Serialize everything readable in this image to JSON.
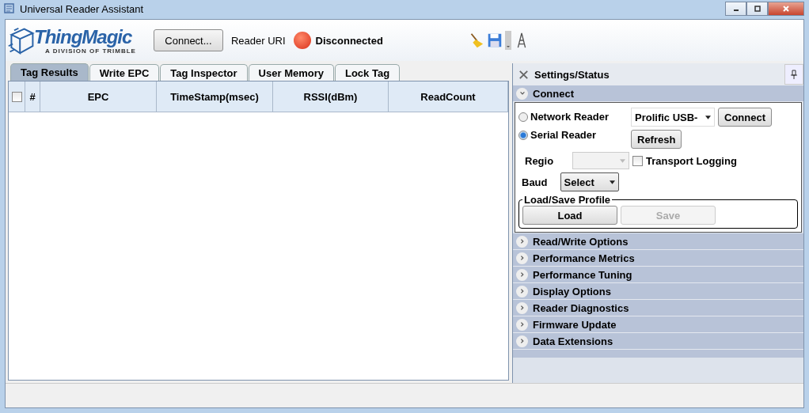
{
  "window": {
    "title": "Universal Reader Assistant"
  },
  "logo": {
    "name": "ThingMagic",
    "tagline": "A DIVISION OF TRIMBLE"
  },
  "toolbar": {
    "connect_button": "Connect...",
    "reader_uri_label": "Reader URI",
    "status": "Disconnected",
    "connected": false
  },
  "tabs": [
    {
      "label": "Tag Results",
      "selected": true
    },
    {
      "label": "Write EPC",
      "selected": false
    },
    {
      "label": "Tag Inspector",
      "selected": false
    },
    {
      "label": "User Memory",
      "selected": false
    },
    {
      "label": "Lock Tag",
      "selected": false
    }
  ],
  "table": {
    "select_all_checked": false,
    "columns": [
      "#",
      "EPC",
      "TimeStamp(msec)",
      "RSSI(dBm)",
      "ReadCount"
    ]
  },
  "settings": {
    "title": "Settings/Status",
    "sections": [
      {
        "title": "Connect",
        "expanded": true
      },
      {
        "title": "Read/Write Options",
        "expanded": false
      },
      {
        "title": "Performance Metrics",
        "expanded": false
      },
      {
        "title": "Performance Tuning",
        "expanded": false
      },
      {
        "title": "Display Options",
        "expanded": false
      },
      {
        "title": "Reader Diagnostics",
        "expanded": false
      },
      {
        "title": "Firmware Update",
        "expanded": false
      },
      {
        "title": "Data Extensions",
        "expanded": false
      }
    ]
  },
  "connect": {
    "reader_types": [
      {
        "label": "Network Reader",
        "selected": false
      },
      {
        "label": "Serial Reader",
        "selected": true
      }
    ],
    "port": "Prolific USB-",
    "connect_button": "Connect",
    "refresh_button": "Refresh",
    "region_label": "Regio",
    "region_disabled": true,
    "transport_logging": {
      "label": "Transport Logging",
      "checked": false
    },
    "baud_label": "Baud",
    "baud": "Select",
    "profile_group": "Load/Save Profile",
    "load": {
      "label": "Load",
      "disabled": false
    },
    "save": {
      "label": "Save",
      "disabled": true
    }
  }
}
